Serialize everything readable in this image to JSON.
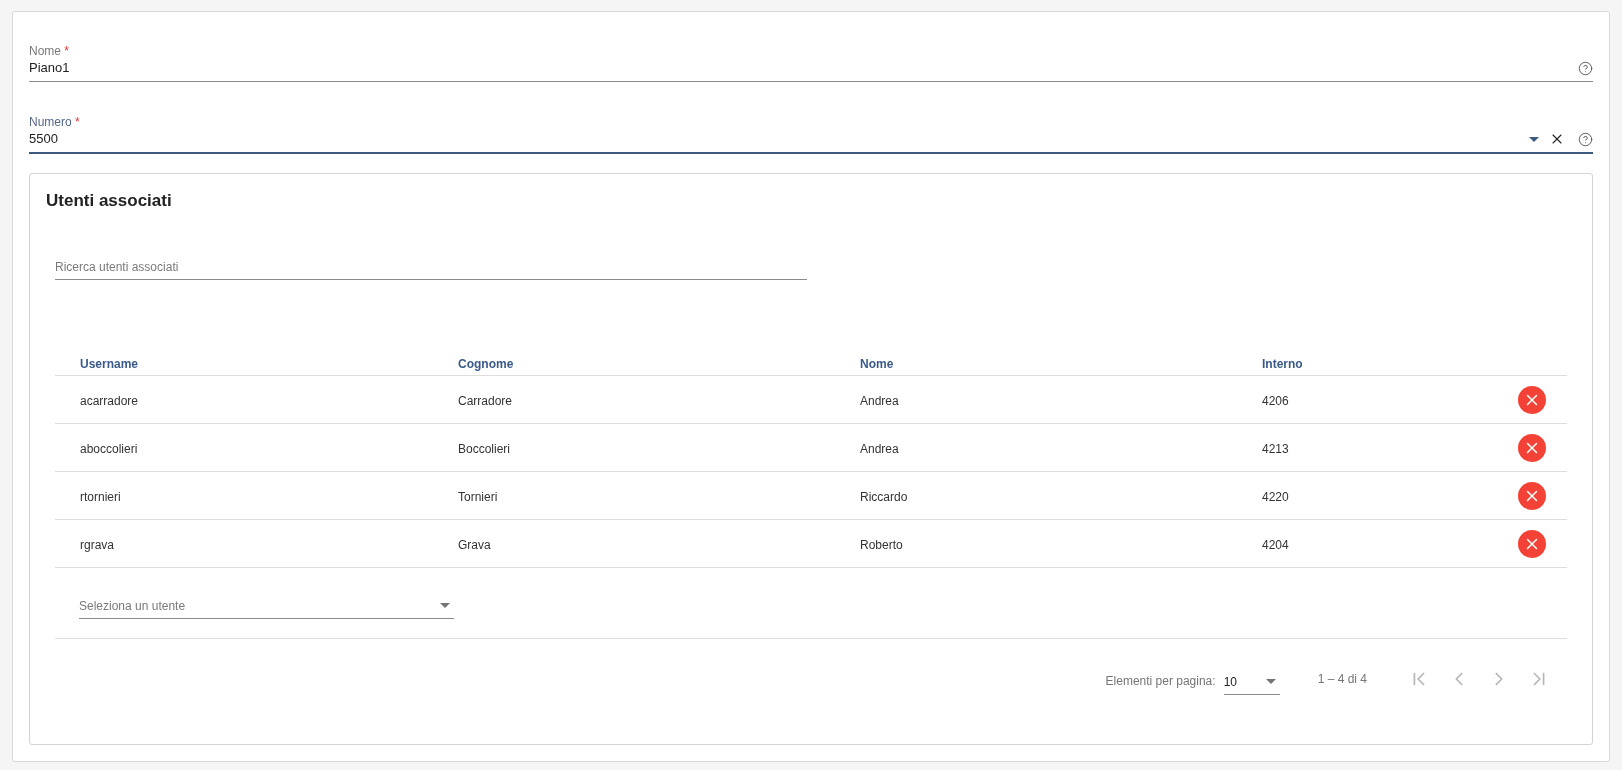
{
  "form": {
    "fields": [
      {
        "kind": "text",
        "label": "Nome",
        "required_mark": "*",
        "value": "Piano1",
        "focused": false
      },
      {
        "kind": "select",
        "label": "Numero",
        "required_mark": "*",
        "value": "5500",
        "focused": true
      }
    ]
  },
  "users_panel": {
    "title": "Utenti associati",
    "search": {
      "placeholder": "Ricerca utenti associati"
    },
    "table": {
      "columns": [
        "Username",
        "Cognome",
        "Nome",
        "Interno"
      ],
      "rows": [
        {
          "cells": [
            "acarradore",
            "Carradore",
            "Andrea",
            "4206"
          ]
        },
        {
          "cells": [
            "aboccolieri",
            "Boccolieri",
            "Andrea",
            "4213"
          ]
        },
        {
          "cells": [
            "rtornieri",
            "Tornieri",
            "Riccardo",
            "4220"
          ]
        },
        {
          "cells": [
            "rgrava",
            "Grava",
            "Roberto",
            "4204"
          ]
        }
      ]
    },
    "user_select": {
      "placeholder": "Seleziona un utente"
    },
    "paginator": {
      "page_size_label": "Elementi per pagina:",
      "page_size": "10",
      "range": "1 – 4 di 4",
      "buttons": [
        {
          "kind": "first",
          "disabled": true
        },
        {
          "kind": "previous",
          "disabled": true
        },
        {
          "kind": "next",
          "disabled": true
        },
        {
          "kind": "last",
          "disabled": true
        }
      ]
    }
  }
}
